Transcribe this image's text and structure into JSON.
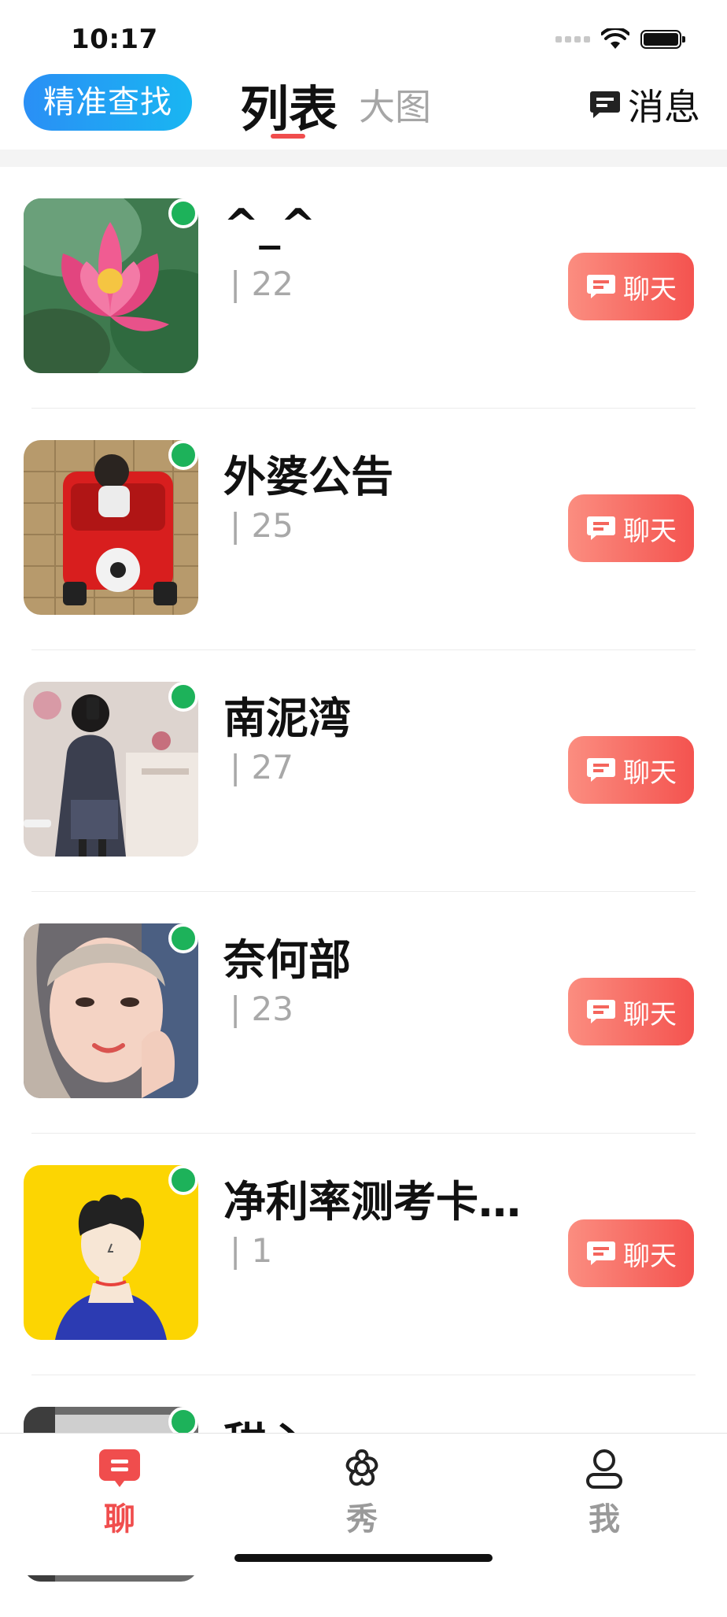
{
  "status_bar": {
    "time": "10:17"
  },
  "header": {
    "precise_search_label": "精准查找",
    "tabs": [
      {
        "label": "列表",
        "active": true
      },
      {
        "label": "大图",
        "active": false
      }
    ],
    "messages_label": "消息",
    "messages_icon": "message-icon"
  },
  "colors": {
    "accent_red": "#f04d4d",
    "search_blue": "#2a8ff5",
    "online_green": "#1db25a",
    "muted_gray": "#a8a8a8"
  },
  "users": [
    {
      "nickname": "^_^",
      "age": "| 22",
      "chat_label": "聊天",
      "online": true,
      "avatar": "lotus-flower"
    },
    {
      "nickname": "外婆公告",
      "age": "| 25",
      "chat_label": "聊天",
      "online": true,
      "avatar": "child-toy-car"
    },
    {
      "nickname": "南泥湾",
      "age": "| 27",
      "chat_label": "聊天",
      "online": true,
      "avatar": "girl-mirror-selfie"
    },
    {
      "nickname": "奈何部",
      "age": "| 23",
      "chat_label": "聊天",
      "online": true,
      "avatar": "woman-portrait"
    },
    {
      "nickname": "净利率测考卡…",
      "age": "| 1",
      "chat_label": "聊天",
      "online": true,
      "avatar": "cartoon-default"
    },
    {
      "nickname": "甜心",
      "online": true,
      "avatar": "partial"
    }
  ],
  "tabbar": {
    "items": [
      {
        "label": "聊",
        "icon": "chat-bubble-icon",
        "active": true
      },
      {
        "label": "秀",
        "icon": "flower-gear-icon",
        "active": false
      },
      {
        "label": "我",
        "icon": "person-icon",
        "active": false
      }
    ]
  }
}
